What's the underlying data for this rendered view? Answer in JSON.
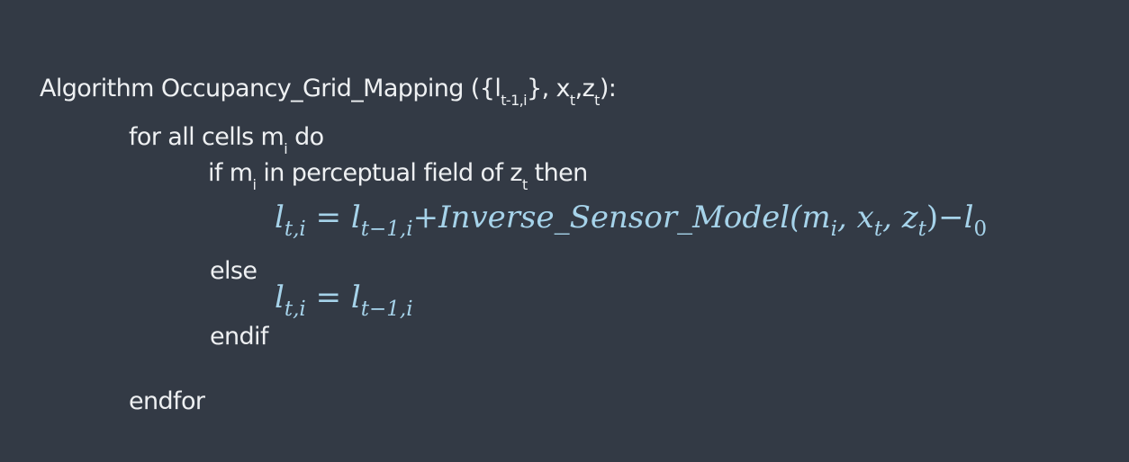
{
  "header": {
    "prefix": "Algorithm Occupancy_Grid_Mapping  ({l",
    "sub1": "t-1,i",
    "mid1": "}, x",
    "sub2": "t",
    "mid2": ",z",
    "sub3": "t",
    "suffix": "):"
  },
  "for_line": {
    "pre": "for all cells m",
    "sub": "i",
    "post": " do"
  },
  "if_line": {
    "pre": "if m",
    "sub": "i",
    "mid": " in perceptual field of z",
    "sub2": "t",
    "post": " then"
  },
  "formula1": {
    "lhs": "l",
    "lhs_sub": "t,i",
    "eq": " = ",
    "l": "l",
    "l_sub": "t−1,i",
    "plus": "+",
    "fn": "Inverse_Sensor_Model(",
    "m": "m",
    "m_sub": "i",
    "c1": ", ",
    "x": "x",
    "x_sub": "t",
    "c2": ", ",
    "z": "z",
    "z_sub": "t",
    "close": ")",
    "minus": "−",
    "l0": "l",
    "l0_sub": "0"
  },
  "else_label": "else",
  "formula2": {
    "lhs": "l",
    "lhs_sub": "t,i",
    "eq": " = ",
    "rhs": "l",
    "rhs_sub": "t−1,i"
  },
  "endif_label": "endif",
  "endfor_label": "endfor",
  "colors": {
    "background": "#333a45",
    "text": "#eef0f2",
    "formula": "#a6d3ea"
  }
}
